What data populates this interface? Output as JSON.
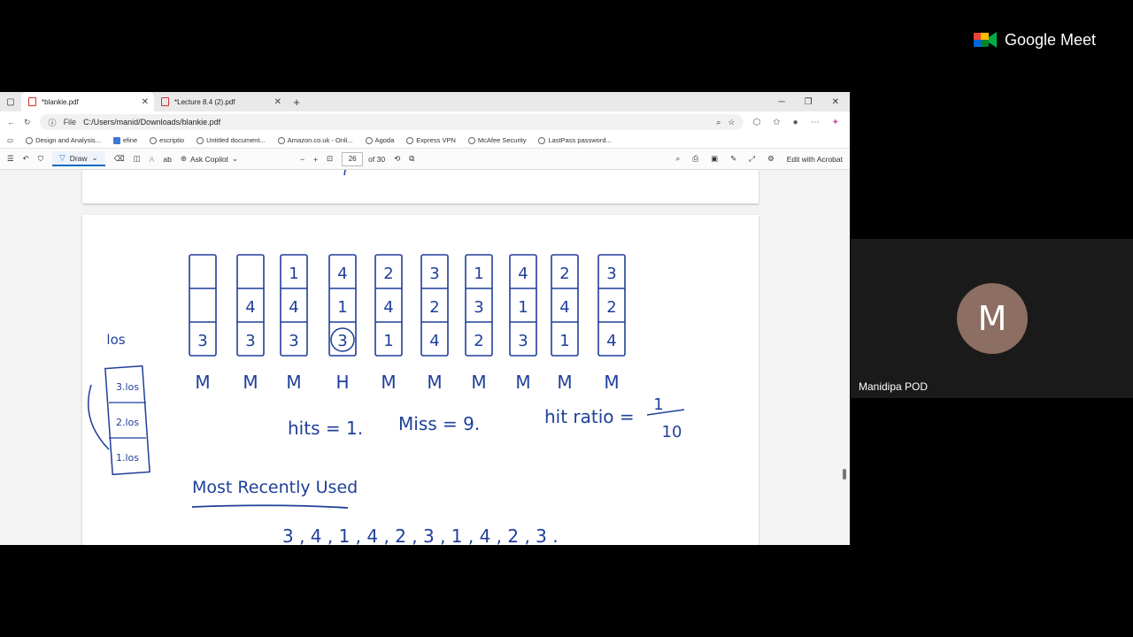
{
  "meet": {
    "brand": "Google Meet",
    "participant_name": "Manidipa POD",
    "avatar_letter": "M"
  },
  "browser": {
    "tabs": [
      {
        "label": "*blankie.pdf"
      },
      {
        "label": "*Lecture 8.4 (2).pdf"
      }
    ],
    "address": {
      "scheme": "File",
      "url": "C:/Users/manid/Downloads/blankie.pdf"
    },
    "bookmarks": [
      "Design and Analysis...",
      "efine",
      "escriptio",
      "Untitled document...",
      "Amazon.co.uk - Onli...",
      "Agoda",
      "Express VPN",
      "McAfee Security",
      "LastPass password..."
    ]
  },
  "pdf_toolbar": {
    "draw_label": "Draw",
    "copilot_label": "Ask Copilot",
    "page_current": "26",
    "page_total": "of 30",
    "acrobat_label": "Edit with Acrobat"
  },
  "handwriting": {
    "frames": [
      [
        "",
        "",
        "3"
      ],
      [
        "",
        "4",
        "3"
      ],
      [
        "1",
        "4",
        "3"
      ],
      [
        "4",
        "1",
        "3"
      ],
      [
        "2",
        "4",
        "1"
      ],
      [
        "3",
        "2",
        "4"
      ],
      [
        "1",
        "3",
        "2"
      ],
      [
        "4",
        "1",
        "3"
      ],
      [
        "2",
        "4",
        "1"
      ],
      [
        "3",
        "2",
        "4"
      ]
    ],
    "results": [
      "M",
      "M",
      "M",
      "H",
      "M",
      "M",
      "M",
      "M",
      "M",
      "M"
    ],
    "timestamp_label": "los",
    "timestamps": [
      "3.los",
      "2.los",
      "1.los"
    ],
    "hits_text": "hits = 1.",
    "miss_text": "Miss = 9.",
    "ratio_label": "hit ratio =",
    "ratio_num": "1",
    "ratio_den": "10",
    "heading": "Most Recently Used",
    "sequence": "3 , 4 , 1 , 4 , 2 , 3 , 1 , 4 , 2 , 3 ."
  },
  "colors": {
    "ink": "#1f3f9a",
    "accent": "#0f6cbd",
    "avatar": "#8d6e63"
  }
}
